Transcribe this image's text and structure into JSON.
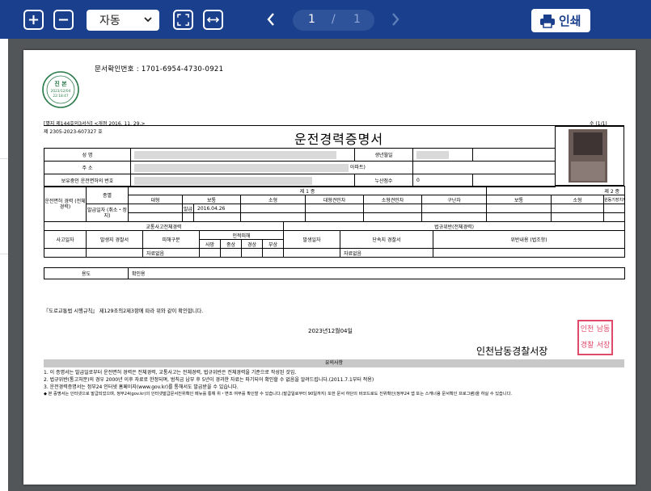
{
  "toolbar": {
    "zoom_value": "자동",
    "page_current": "1",
    "page_separator": "/",
    "page_total": "1",
    "print_label": "인쇄",
    "icons": [
      "zoom-in-icon",
      "zoom-out-icon",
      "fit-page-icon",
      "fit-width-icon",
      "prev-page-icon",
      "next-page-icon",
      "printer-icon"
    ],
    "colors": {
      "toolbar": "#1a3f8c",
      "viewer": "#525659"
    }
  },
  "document": {
    "doc_check_label": "문서확인번호 :",
    "doc_check_number": "1701-6954-4730-0921",
    "stamp": {
      "line1": "진 본",
      "date": "2023/12/04",
      "time": "22:18:47"
    },
    "form_no": "[별지 제144호의3서식] <개정 2016. 11. 29.>",
    "page_index": "수 (1/1)",
    "cert_no": "제 2305-2023-607327 호",
    "title": "운전경력증명서",
    "info": {
      "name_label": "성    명",
      "birth_label": "생년월일",
      "address_label": "주    소",
      "address_suffix": "아파트)",
      "license_label": "보유중인 운전면허의 번호",
      "points_label": "누산점수",
      "points_value": "0"
    },
    "license": {
      "history_label": "운전면허 경력 (전체경력)",
      "kind_label": "종별",
      "issue_label": "발급일자 (취소・정지)",
      "class1_header": "제 1 종",
      "class2_header": "제 2 종",
      "class1_cols": [
        "대형",
        "보통",
        "소형",
        "대형견인차",
        "소형견인차",
        "구난차"
      ],
      "class2_cols": [
        "보통",
        "소형",
        "원동기장치자전거(다륜)"
      ],
      "issue_type": "발급",
      "issue_date": "2016.04.26"
    },
    "accident": {
      "traffic_header": "교통사고전체경력",
      "violation_header": "법규위반(전체경력)",
      "date_label": "사고일자",
      "police_label": "발생지 경찰서",
      "damage_label": "피해구분",
      "casualty_header": "인적피해",
      "casualty_cols": [
        "사망",
        "중상",
        "경상",
        "부상"
      ],
      "occur_label": "발생일자",
      "enforce_label": "단속지 경찰서",
      "content_label": "위반내용 (법조항)",
      "no_data_left": "자료없음",
      "no_data_right": "자료없음"
    },
    "usage": {
      "label": "용도",
      "value": "확인용"
    },
    "law_text": "『도로교통법 시행규칙』 제129조의2제3항에 따라 위와 같이 확인합니다.",
    "issue_date": "2023년12월04일",
    "station": "인천남동경찰서장",
    "seal_chars": [
      "인천",
      "남동",
      "경찰",
      "서장"
    ],
    "notice_title": "유의사항",
    "notes": [
      "1. 이 증명서는 발급일로부터 운전면허 경력은 전체경력, 교통사고는 전체경력, 법규위반은 전체경력을 기준으로 작성된 것임.",
      "2. 법규위반(통고처분)의 경우 2000년 이후 자료로 한정되며, 범칙금 납부 후 5년이 경과한 자료는 파기되어 확인할 수 없음을 알려드립니다.(2011.7.1부터 적용)",
      "3. 운전경력증명서는 정부24 인터넷 홈페이지(www.gov.kr)를 통해서도 발급받을 수 있습니다."
    ],
    "bottom_note": "◆ 본 증명서는 인터넷으로 발급되었으며, 정부24(gov.kr)의 인터넷발급문서진위확인 메뉴를 통해 위・변조 여부를 확인할 수 있습니다.(발급일로부터 90일까지) 또한 문서 하단의 바코드로도 진위확인(정부24 앱 또는 스캐너용 문서확인 프로그램)을 하실 수 있습니다."
  }
}
